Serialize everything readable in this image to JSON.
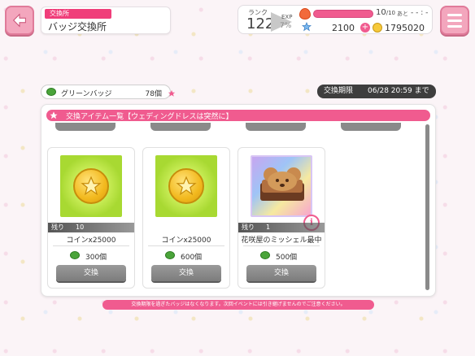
{
  "header": {
    "tag": "交換所",
    "title": "バッジ交換所"
  },
  "status": {
    "rank_label": "ランク",
    "rank_value": "122",
    "exp_label": "EXP",
    "exp_value": "7%",
    "life_value": "10",
    "life_max": "/10",
    "life_ato": "あと",
    "life_time": "- - : -",
    "star_value": "2100",
    "coin_value": "1795020"
  },
  "badge": {
    "name": "グリーンバッジ",
    "count": "78個"
  },
  "period": {
    "label": "交換期限",
    "value": "06/28 20:59 まで"
  },
  "panel": {
    "title": "交換アイテム一覧【ウェディングドレスは突然に】"
  },
  "cards": [
    {
      "remain_label": "残り",
      "remain": "10",
      "name": "コインx25000",
      "price": "300個",
      "button": "交換"
    },
    {
      "remain_label": "",
      "remain": "",
      "name": "コインx25000",
      "price": "600個",
      "button": "交換"
    },
    {
      "remain_label": "残り",
      "remain": "1",
      "name": "花咲屋のミッシェル最中",
      "price": "500個",
      "button": "交換"
    }
  ],
  "notice": "交換期限を過ぎたバッジはなくなります。次回イベントには引き継げませんのでご注意ください。",
  "colors": {
    "accent": "#f05b8f",
    "button_gray": "#8a8a8a"
  }
}
